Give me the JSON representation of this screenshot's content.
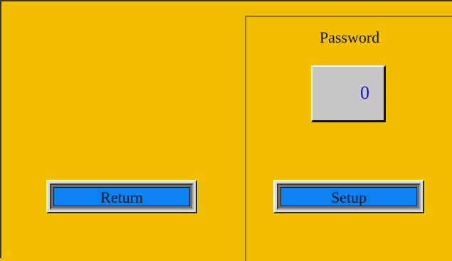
{
  "password": {
    "label": "Password",
    "value": "0"
  },
  "buttons": {
    "return_label": "Return",
    "setup_label": "Setup"
  },
  "colors": {
    "background": "#f2bf00",
    "button_face": "#0a82f0",
    "value_text": "#1414d9"
  }
}
